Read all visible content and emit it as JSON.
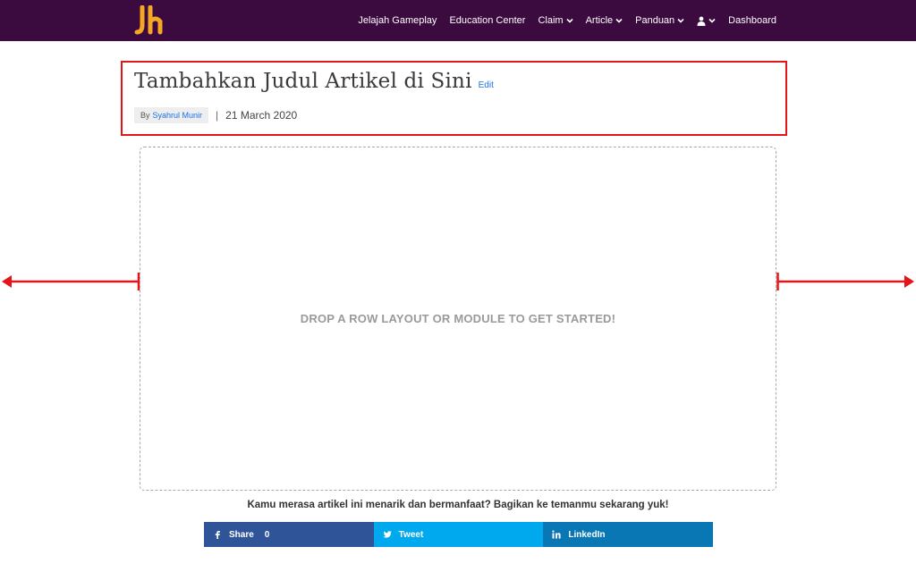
{
  "header": {
    "nav_items": [
      {
        "label": "Jelajah Gameplay",
        "dropdown": false
      },
      {
        "label": "Education Center",
        "dropdown": false
      },
      {
        "label": "Claim",
        "dropdown": true
      },
      {
        "label": "Article",
        "dropdown": true
      },
      {
        "label": "Panduan",
        "dropdown": true
      },
      {
        "label": "",
        "icon": "user-icon",
        "dropdown": true
      },
      {
        "label": "Dashboard",
        "dropdown": false
      }
    ],
    "colors": {
      "background": "#3b0a3f",
      "logo": "#f5a623"
    }
  },
  "article": {
    "title": "Tambahkan Judul Artikel di Sini",
    "edit_label": "Edit",
    "by_label": "By",
    "author": "Syahrul Munir",
    "separator": "|",
    "date": "21 March 2020"
  },
  "builder": {
    "drop_text": "DROP A ROW LAYOUT OR MODULE TO GET STARTED!"
  },
  "share": {
    "prompt": "Kamu merasa artikel ini menarik dan bermanfaat? Bagikan ke temanmu sekarang yuk!",
    "facebook_label": "Share",
    "facebook_count": "0",
    "twitter_label": "Tweet",
    "linkedin_label": "LinkedIn",
    "colors": {
      "facebook": "#2f5598",
      "twitter": "#00a9ed",
      "linkedin": "#0a77b5"
    }
  },
  "annotation_colors": {
    "highlight": "#e3151a"
  }
}
